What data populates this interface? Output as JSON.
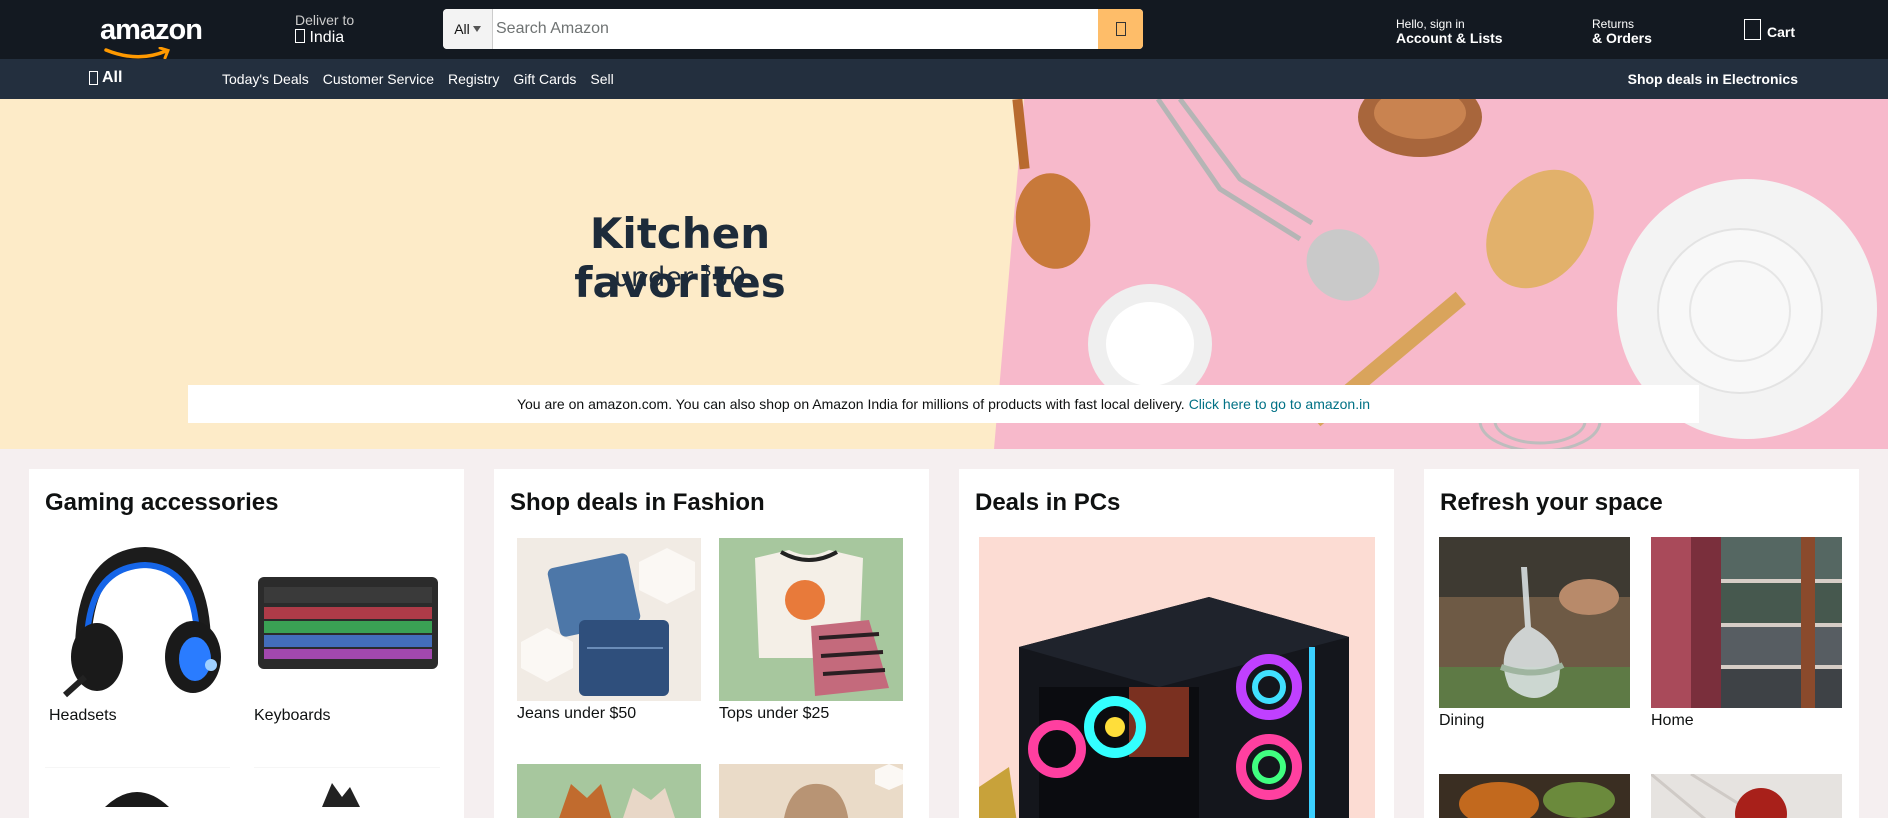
{
  "header": {
    "logo_text": "amazon",
    "deliver_label": "Deliver to",
    "deliver_location": "India",
    "search_category": "All",
    "search_placeholder": "Search Amazon",
    "account_greeting": "Hello, sign in",
    "account_label": "Account & Lists",
    "returns_label": "Returns",
    "orders_label": "& Orders",
    "cart_label": "Cart"
  },
  "subnav": {
    "all_label": "All",
    "links": [
      "Today's Deals",
      "Customer Service",
      "Registry",
      "Gift Cards",
      "Sell"
    ],
    "right_link": "Shop deals in Electronics"
  },
  "hero": {
    "title": "Kitchen favorites",
    "subtitle_prefix": "under ",
    "subtitle_currency": "$",
    "subtitle_amount": "50",
    "notice_text": "You are on amazon.com. You can also shop on Amazon India for millions of products with fast local delivery.",
    "notice_link": "Click here to go to amazon.in"
  },
  "cards": [
    {
      "title": "Gaming accessories",
      "tiles": [
        "Headsets",
        "Keyboards"
      ]
    },
    {
      "title": "Shop deals in Fashion",
      "tiles": [
        "Jeans under $50",
        "Tops under $25"
      ]
    },
    {
      "title": "Deals in PCs"
    },
    {
      "title": "Refresh your space",
      "tiles": [
        "Dining",
        "Home"
      ]
    }
  ],
  "colors": {
    "header_bg": "#131921",
    "subnav_bg": "#232f3e",
    "search_button": "#febd69",
    "hero_cream": "#fdebc8",
    "hero_pink": "#f7b9cb",
    "link": "#007185"
  }
}
